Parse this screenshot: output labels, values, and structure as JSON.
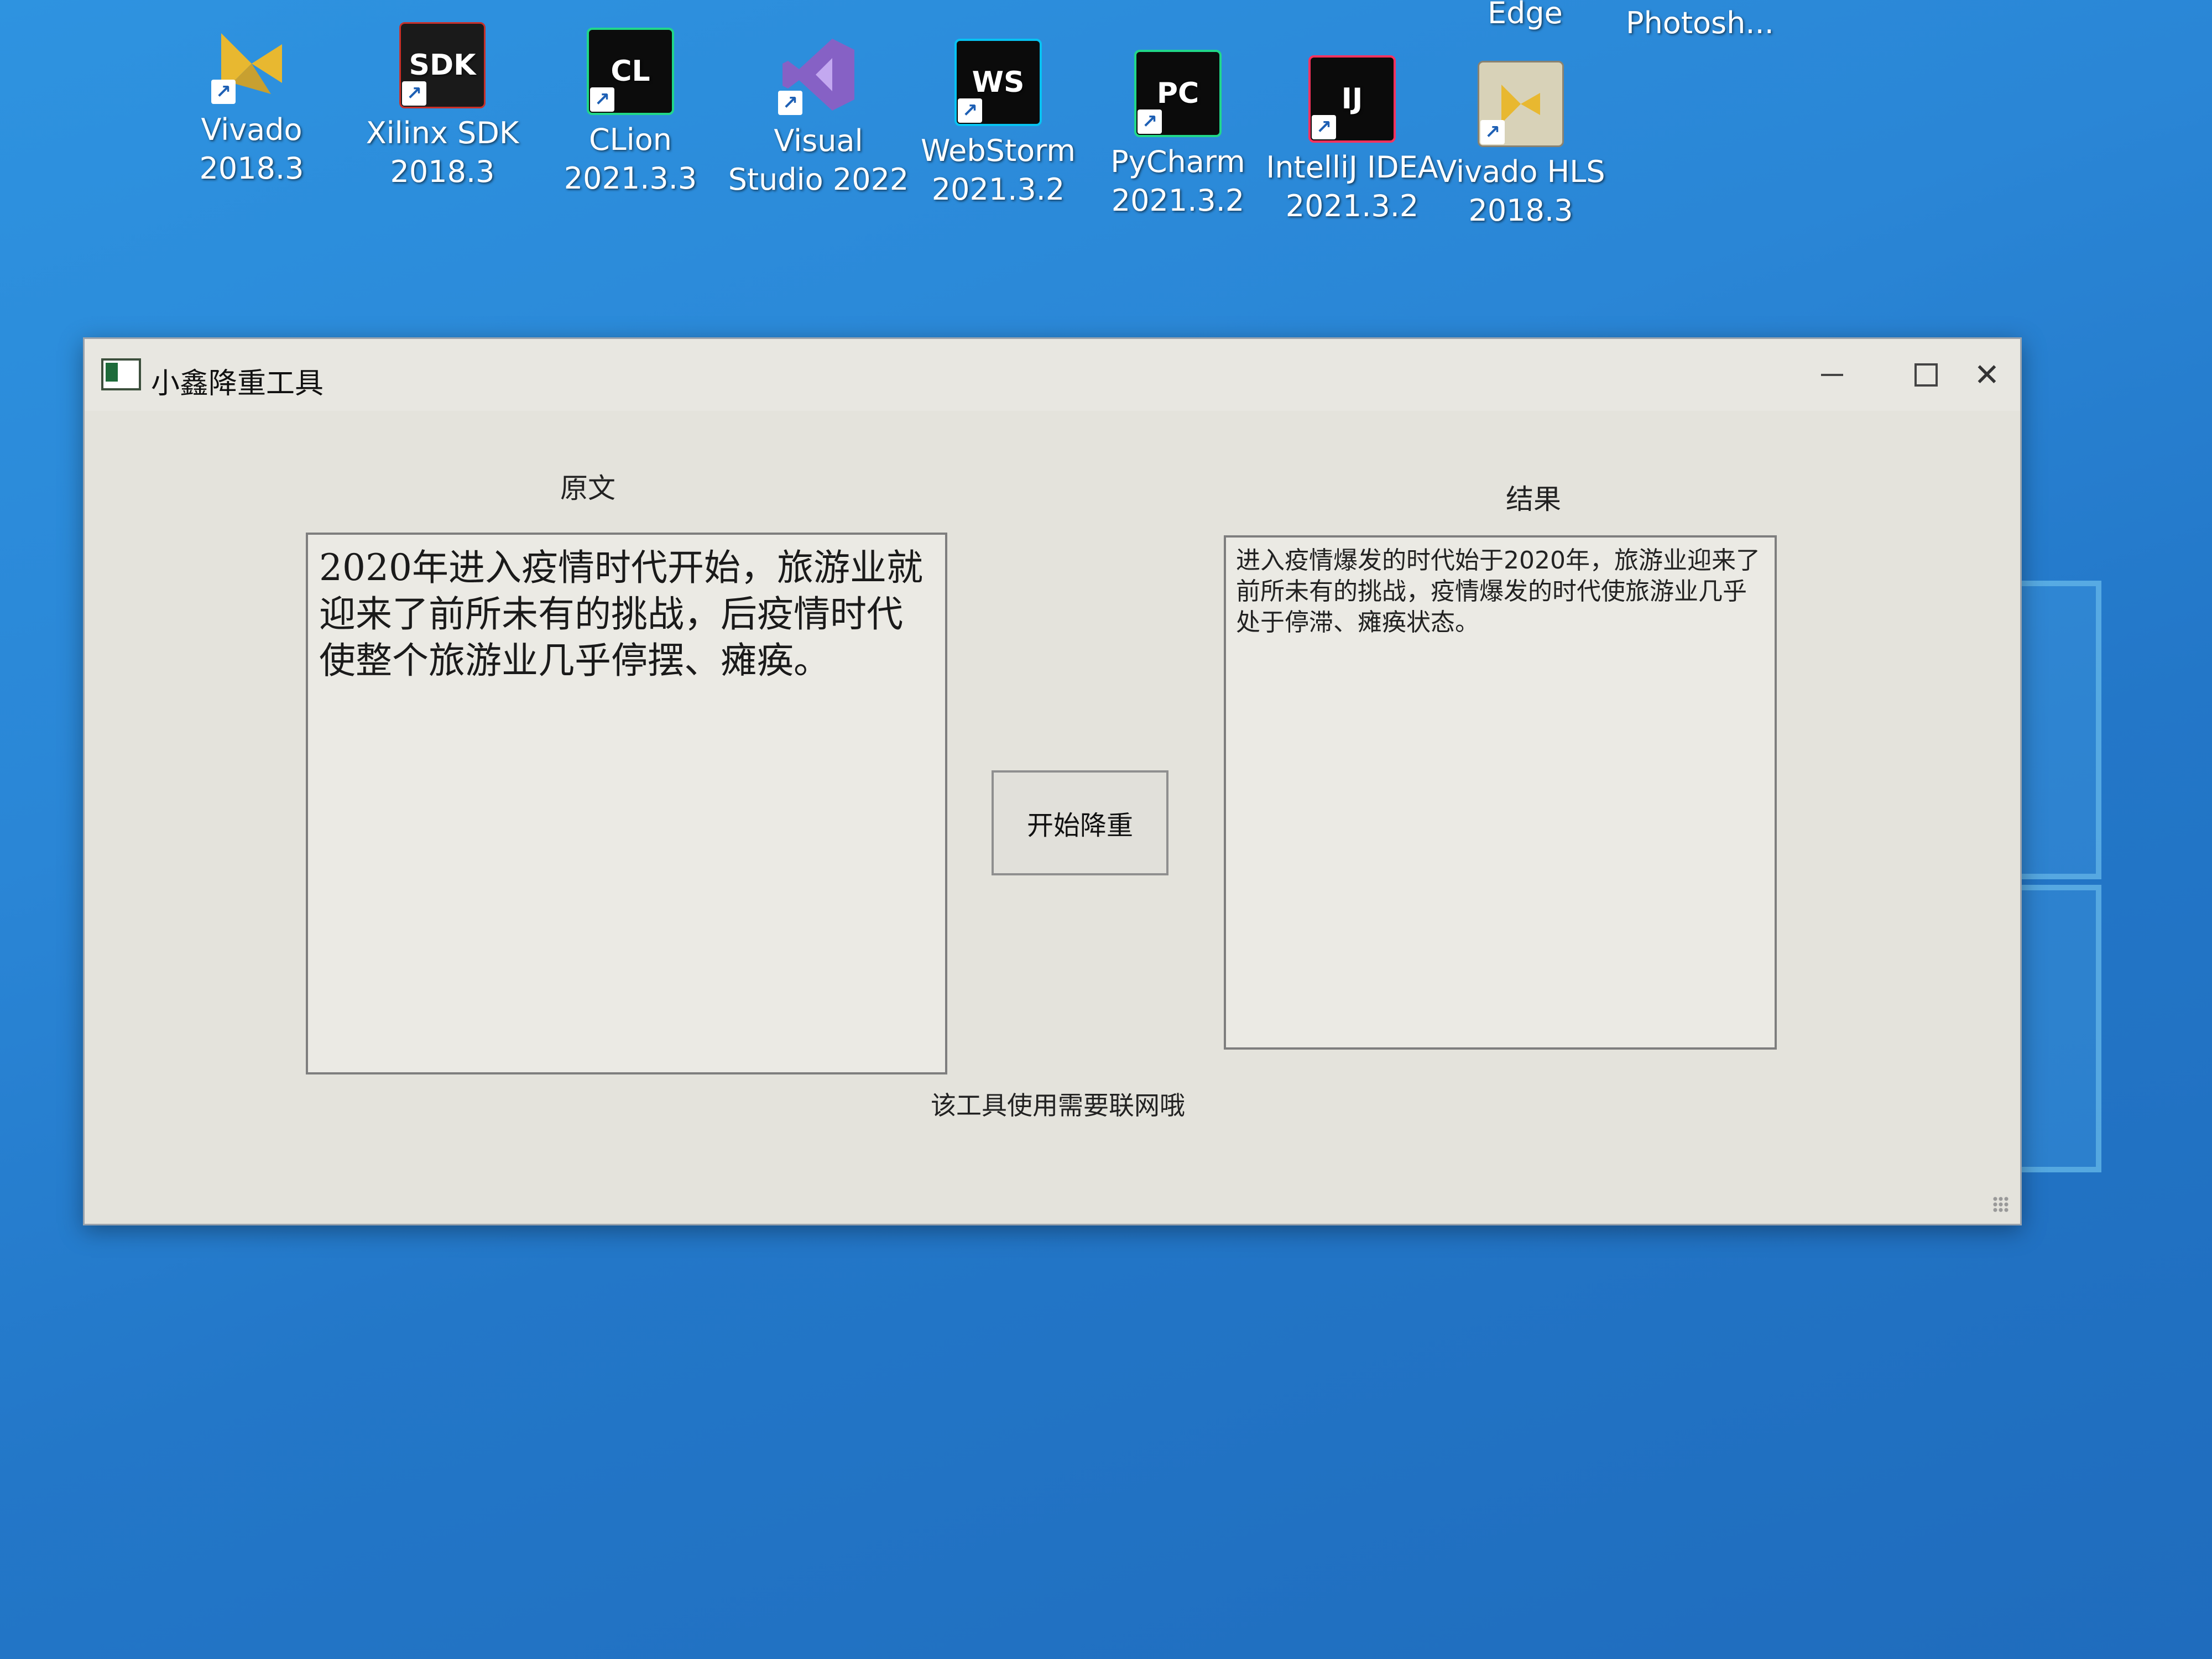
{
  "desktop": {
    "icons": [
      {
        "name": "Vivado",
        "line1": "Vivado",
        "line2": "2018.3",
        "glyph": "",
        "color": "#e9b93a"
      },
      {
        "name": "Xilinx SDK",
        "line1": "Xilinx SDK",
        "line2": "2018.3",
        "glyph": "SDK",
        "color": "#1a1a1a"
      },
      {
        "name": "CLion",
        "line1": "CLion",
        "line2": "2021.3.3",
        "glyph": "CL",
        "color": "#0c0c0c"
      },
      {
        "name": "Visual Studio 2022",
        "line1": "Visual",
        "line2": "Studio 2022",
        "glyph": "",
        "color": "#7b57c7"
      },
      {
        "name": "WebStorm",
        "line1": "WebStorm",
        "line2": "2021.3.2",
        "glyph": "WS",
        "color": "#0b0b0b"
      },
      {
        "name": "PyCharm",
        "line1": "PyCharm",
        "line2": "2021.3.2",
        "glyph": "PC",
        "color": "#0b0b0b"
      },
      {
        "name": "IntelliJ IDEA",
        "line1": "IntelliJ IDEA",
        "line2": "2021.3.2",
        "glyph": "IJ",
        "color": "#0b0b0b"
      },
      {
        "name": "Vivado HLS",
        "line1": "Vivado HLS",
        "line2": "2018.3",
        "glyph": "",
        "color": "#d8d2b8"
      }
    ],
    "top_labels": {
      "edge": "Edge",
      "photoshop": "Photosh..."
    }
  },
  "window": {
    "title": "小鑫降重工具",
    "source_label": "原文",
    "result_label": "结果",
    "source_text": "2020年进入疫情时代开始，旅游业就迎来了前所未有的挑战，后疫情时代使整个旅游业几乎停摆、瘫痪。",
    "result_text": "进入疫情爆发的时代始于2020年，旅游业迎来了前所未有的挑战，疫情爆发的时代使旅游业几乎处于停滞、瘫痪状态。",
    "start_button": "开始降重",
    "footer_note": "该工具使用需要联网哦"
  }
}
